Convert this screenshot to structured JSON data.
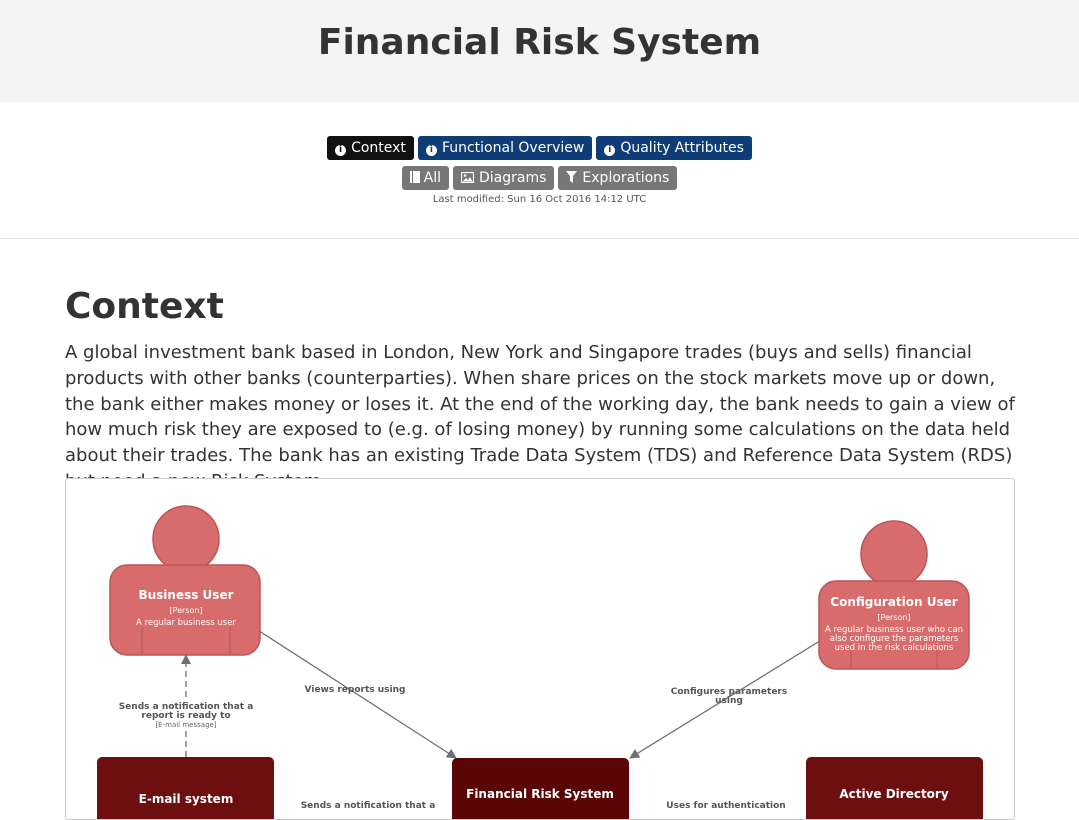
{
  "page": {
    "title": "Financial Risk System"
  },
  "nav": {
    "row1": [
      {
        "label": "Context",
        "icon": "info-icon",
        "style": "active"
      },
      {
        "label": "Functional Overview",
        "icon": "info-icon",
        "style": "blue"
      },
      {
        "label": "Quality Attributes",
        "icon": "info-icon",
        "style": "blue"
      }
    ],
    "row2": [
      {
        "label": "All",
        "icon": "document-icon",
        "style": "grey"
      },
      {
        "label": "Diagrams",
        "icon": "image-icon",
        "style": "grey"
      },
      {
        "label": "Explorations",
        "icon": "filter-icon",
        "style": "grey"
      }
    ],
    "last_modified": "Last modified: Sun 16 Oct 2016 14:12 UTC"
  },
  "section": {
    "title": "Context",
    "body": "A global investment bank based in London, New York and Singapore trades (buys and sells) financial products with other banks (counterparties). When share prices on the stock markets move up or down, the bank either makes money or loses it. At the end of the working day, the bank needs to gain a view of how much risk they are exposed to (e.g. of losing money) by running some calculations on the data held about their trades. The bank has an existing Trade Data System (TDS) and Reference Data System (RDS) but need a new Risk System."
  },
  "diagram": {
    "colors": {
      "person": "#d86c6c",
      "person_stroke": "#b95656",
      "system": "#6e0f0f",
      "system_focus": "#5a0606",
      "edge": "#707070"
    },
    "people": [
      {
        "id": "business-user",
        "name": "Business User",
        "type": "[Person]",
        "desc": [
          "A regular business user"
        ]
      },
      {
        "id": "configuration-user",
        "name": "Configuration User",
        "type": "[Person]",
        "desc": [
          "A regular business user who can",
          "also configure the parameters",
          "used in the risk calculations"
        ]
      }
    ],
    "systems": [
      {
        "id": "email-system",
        "name": "E-mail system"
      },
      {
        "id": "financial-risk-system",
        "name": "Financial Risk System"
      },
      {
        "id": "active-directory",
        "name": "Active Directory"
      }
    ],
    "edges": [
      {
        "id": "views-reports",
        "label": [
          "Views reports using"
        ],
        "tech": ""
      },
      {
        "id": "configures-parameters",
        "label": [
          "Configures parameters",
          "using"
        ],
        "tech": ""
      },
      {
        "id": "sends-notification-user",
        "label": [
          "Sends a notification that a",
          "report is ready to"
        ],
        "tech": "[E-mail message]"
      },
      {
        "id": "sends-notification-email",
        "label": [
          "Sends a notification that a"
        ],
        "tech": ""
      },
      {
        "id": "uses-authentication",
        "label": [
          "Uses for authentication"
        ],
        "tech": ""
      }
    ]
  }
}
